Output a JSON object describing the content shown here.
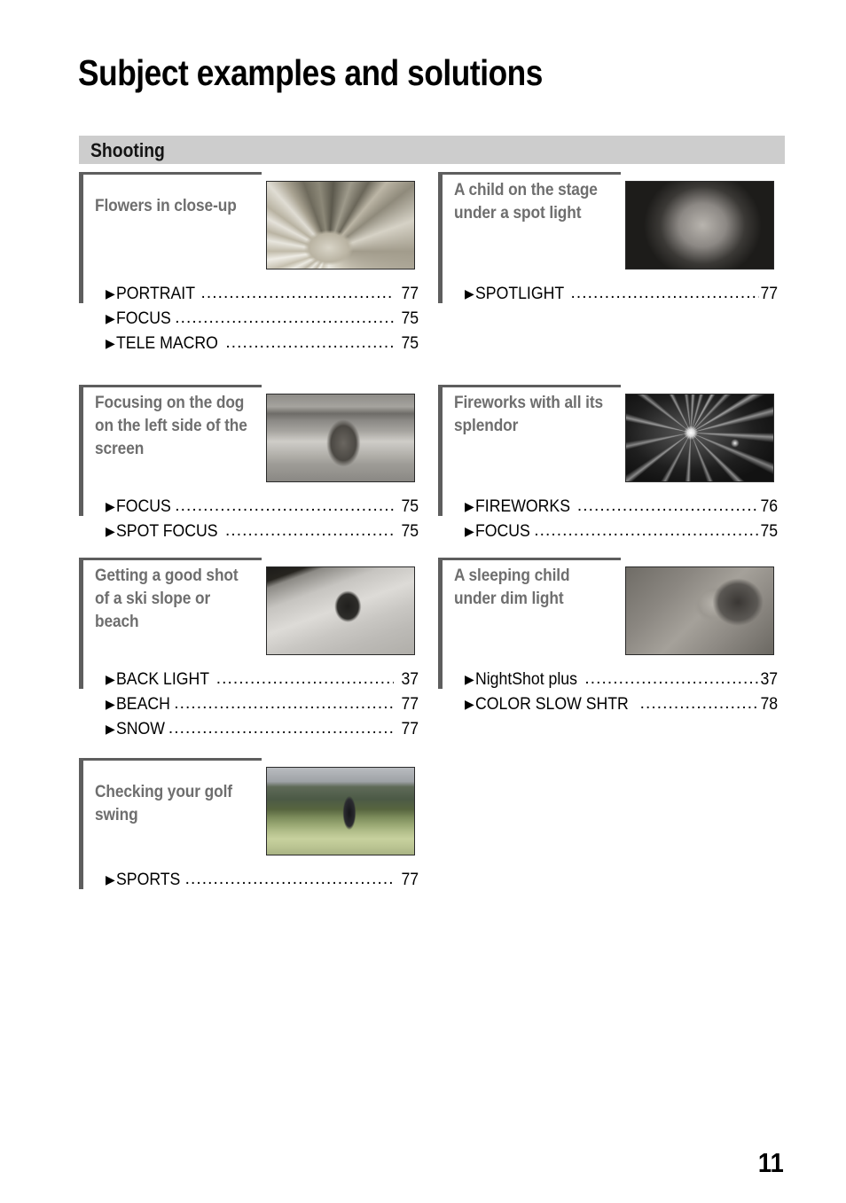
{
  "page": {
    "title": "Subject examples and solutions",
    "folio": "11"
  },
  "section": {
    "label": "Shooting"
  },
  "bullet_glyph": "▶",
  "leader_dots": "..................................................................................................",
  "columns": {
    "left": [
      {
        "title": "Flowers in close-up",
        "image_name": "flower-close-up-photo",
        "refs": [
          {
            "label": "PORTRAIT",
            "page": "77"
          },
          {
            "label": "FOCUS",
            "page": "75"
          },
          {
            "label": "TELE MACRO",
            "page": "75"
          }
        ]
      },
      {
        "title": "Focusing on the dog on the left side of the screen",
        "image_name": "dog-on-left-side-photo",
        "refs": [
          {
            "label": "FOCUS",
            "page": "75"
          },
          {
            "label": "SPOT FOCUS",
            "page": "75"
          }
        ]
      },
      {
        "title": "Getting a good shot of a ski slope or beach",
        "image_name": "ski-slope-photo",
        "refs": [
          {
            "label": "BACK LIGHT",
            "page": "37"
          },
          {
            "label": "BEACH",
            "page": "77"
          },
          {
            "label": "SNOW",
            "page": "77"
          }
        ]
      },
      {
        "title": "Checking your golf swing",
        "image_name": "golf-swing-photo",
        "refs": [
          {
            "label": "SPORTS",
            "page": "77"
          }
        ]
      }
    ],
    "right": [
      {
        "title": "A child on the stage under a spot light",
        "image_name": "child-on-stage-photo",
        "refs": [
          {
            "label": "SPOTLIGHT",
            "page": "77"
          }
        ]
      },
      {
        "title": "Fireworks with all its splendor",
        "image_name": "fireworks-photo",
        "refs": [
          {
            "label": "FIREWORKS",
            "page": "76"
          },
          {
            "label": "FOCUS",
            "page": "75"
          }
        ]
      },
      {
        "title": "A sleeping child under dim light",
        "image_name": "sleeping-child-photo",
        "refs": [
          {
            "label": "NightShot plus",
            "page": "37"
          },
          {
            "label": "COLOR SLOW SHTR",
            "page": "78"
          }
        ]
      }
    ]
  },
  "colors": {
    "section_bar": "#cdcdcd",
    "rule": "#5e5e5e",
    "entry_title": "#6e6e6e",
    "text": "#000000"
  }
}
